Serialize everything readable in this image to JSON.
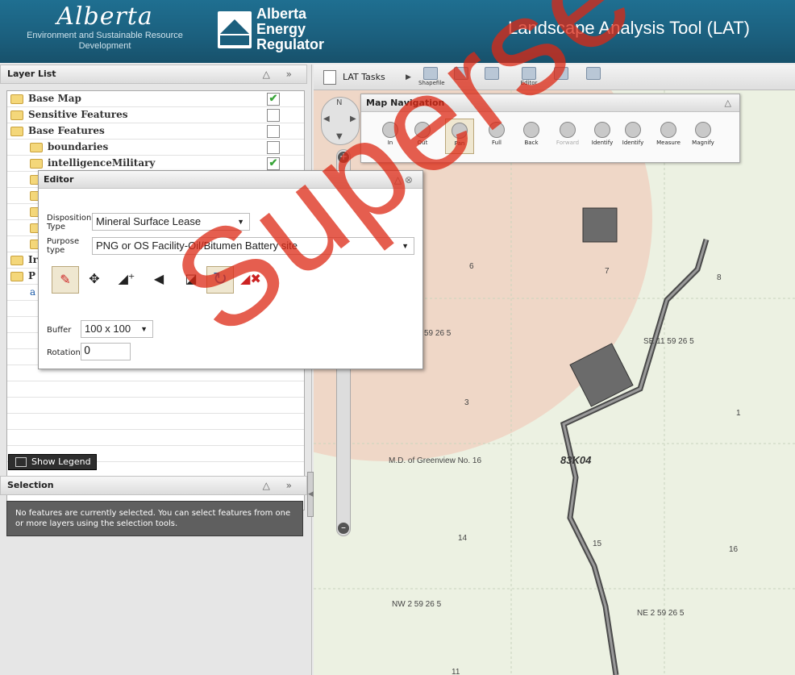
{
  "header": {
    "gov_logo_script": "Alberta",
    "gov_dept": "Environment and Sustainable Resource Development",
    "regulator_name": [
      "Alberta",
      "Energy",
      "Regulator"
    ],
    "app_title": "Landscape Analysis Tool (LAT)"
  },
  "layer_list": {
    "title": "Layer List",
    "items": [
      {
        "label": "Base Map",
        "checked": true,
        "indent": 0
      },
      {
        "label": "Sensitive Features",
        "checked": false,
        "indent": 0
      },
      {
        "label": "Base Features",
        "checked": false,
        "indent": 0
      },
      {
        "label": "boundaries",
        "checked": false,
        "indent": 1
      },
      {
        "label": "intelligenceMilitary",
        "checked": true,
        "indent": 1
      }
    ],
    "partial_items": [
      "Ir",
      "P",
      "a"
    ],
    "show_legend": "Show Legend"
  },
  "selection": {
    "title": "Selection",
    "message": "No features are currently selected. You can select features from one or more layers using the selection tools."
  },
  "toolbar": {
    "lat_tasks": "LAT Tasks",
    "tools": [
      {
        "label": "Shapefile",
        "icon": "shapefile-icon"
      },
      {
        "label": "",
        "icon": "star-edit-icon"
      },
      {
        "label": "",
        "icon": "info-edit-icon"
      },
      {
        "label": "Editor",
        "icon": "editor-icon"
      },
      {
        "label": "",
        "icon": "print-icon"
      },
      {
        "label": "",
        "icon": "export-icon"
      }
    ]
  },
  "map_navigation": {
    "title": "Map Navigation",
    "tools": [
      {
        "label": "In",
        "icon": "zoom-in-icon"
      },
      {
        "label": "Out",
        "icon": "zoom-out-icon"
      },
      {
        "label": "Pan",
        "icon": "pan-hand-icon",
        "active": true
      },
      {
        "label": "Full",
        "icon": "globe-icon"
      },
      {
        "label": "Back",
        "icon": "back-arrow-icon"
      },
      {
        "label": "Forward",
        "icon": "forward-arrow-icon",
        "disabled": true
      },
      {
        "label": "Identify",
        "icon": "identify-icon"
      },
      {
        "label": "Identify",
        "icon": "identify-multi-icon"
      },
      {
        "label": "Measure",
        "icon": "measure-icon"
      },
      {
        "label": "Magnify",
        "icon": "magnify-icon"
      }
    ]
  },
  "editor": {
    "title": "Editor",
    "disposition_label_1": "Disposition",
    "disposition_label_2": "Type",
    "disposition_value": "Mineral Surface Lease",
    "purpose_label_1": "Purpose",
    "purpose_label_2": "type",
    "purpose_value": "PNG or OS Facility-Oil/Bitumen Battery site",
    "buffer_label": "Buffer",
    "buffer_value": "100 x 100",
    "rotation_label": "Rotation",
    "rotation_value": "0",
    "tools": [
      "pencil-icon",
      "move-icon",
      "add-vertex-icon",
      "vertex-icon",
      "reshape-icon",
      "rotate-icon",
      "delete-vertex-icon"
    ]
  },
  "map": {
    "labels": [
      {
        "text": "6"
      },
      {
        "text": "7"
      },
      {
        "text": "8"
      },
      {
        "text": "59 26 5"
      },
      {
        "text": "SE 11 59 26 5"
      },
      {
        "text": "3"
      },
      {
        "text": "1"
      },
      {
        "text": "M.D. of Greenview No. 16"
      },
      {
        "text": "83K04"
      },
      {
        "text": "14"
      },
      {
        "text": "15"
      },
      {
        "text": "16"
      },
      {
        "text": "NW 2 59 26 5"
      },
      {
        "text": "NE 2 59 26 5"
      },
      {
        "text": "11"
      }
    ]
  },
  "watermark": "Supersede"
}
